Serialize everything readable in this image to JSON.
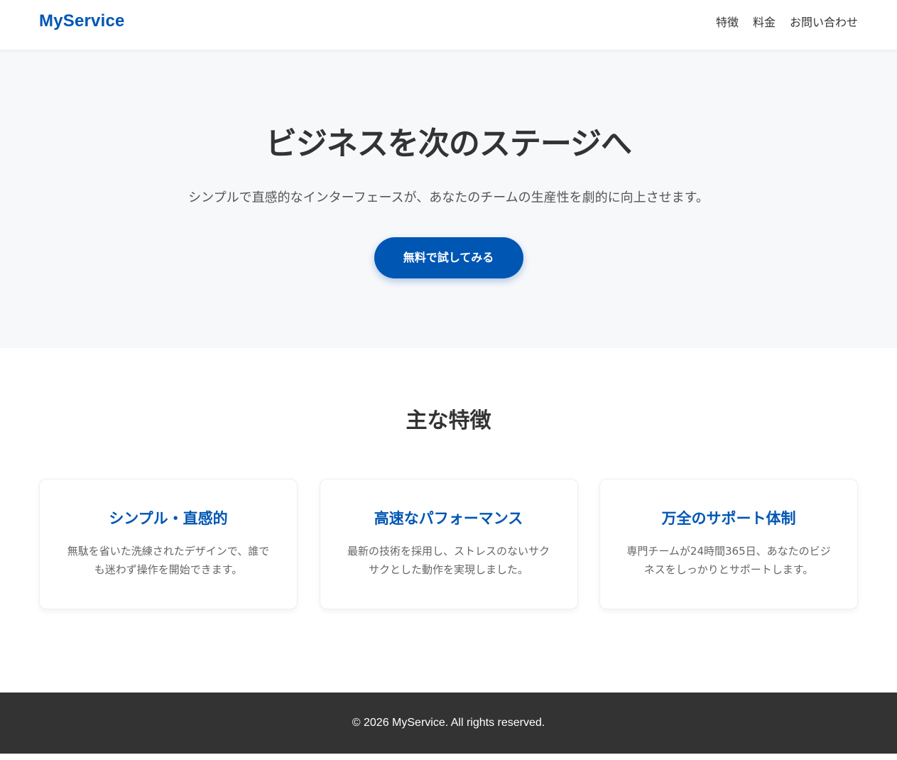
{
  "header": {
    "logo": "MyService",
    "nav": [
      {
        "label": "特徴"
      },
      {
        "label": "料金"
      },
      {
        "label": "お問い合わせ"
      }
    ]
  },
  "hero": {
    "title": "ビジネスを次のステージへ",
    "subtitle": "シンプルで直感的なインターフェースが、あなたのチームの生産性を劇的に向上させます。",
    "cta_label": "無料で試してみる"
  },
  "features": {
    "title": "主な特徴",
    "cards": [
      {
        "title": "シンプル・直感的",
        "text": "無駄を省いた洗練されたデザインで、誰でも迷わず操作を開始できます。"
      },
      {
        "title": "高速なパフォーマンス",
        "text": "最新の技術を採用し、ストレスのないサクサクとした動作を実現しました。"
      },
      {
        "title": "万全のサポート体制",
        "text": "専門チームが24時間365日、あなたのビジネスをしっかりとサポートします。"
      }
    ]
  },
  "footer": {
    "copyright": "© 2026 MyService. All rights reserved."
  },
  "colors": {
    "brand": "#0056b3",
    "hero_bg": "#f7f8fa",
    "footer_bg": "#333333",
    "text": "#333333"
  }
}
